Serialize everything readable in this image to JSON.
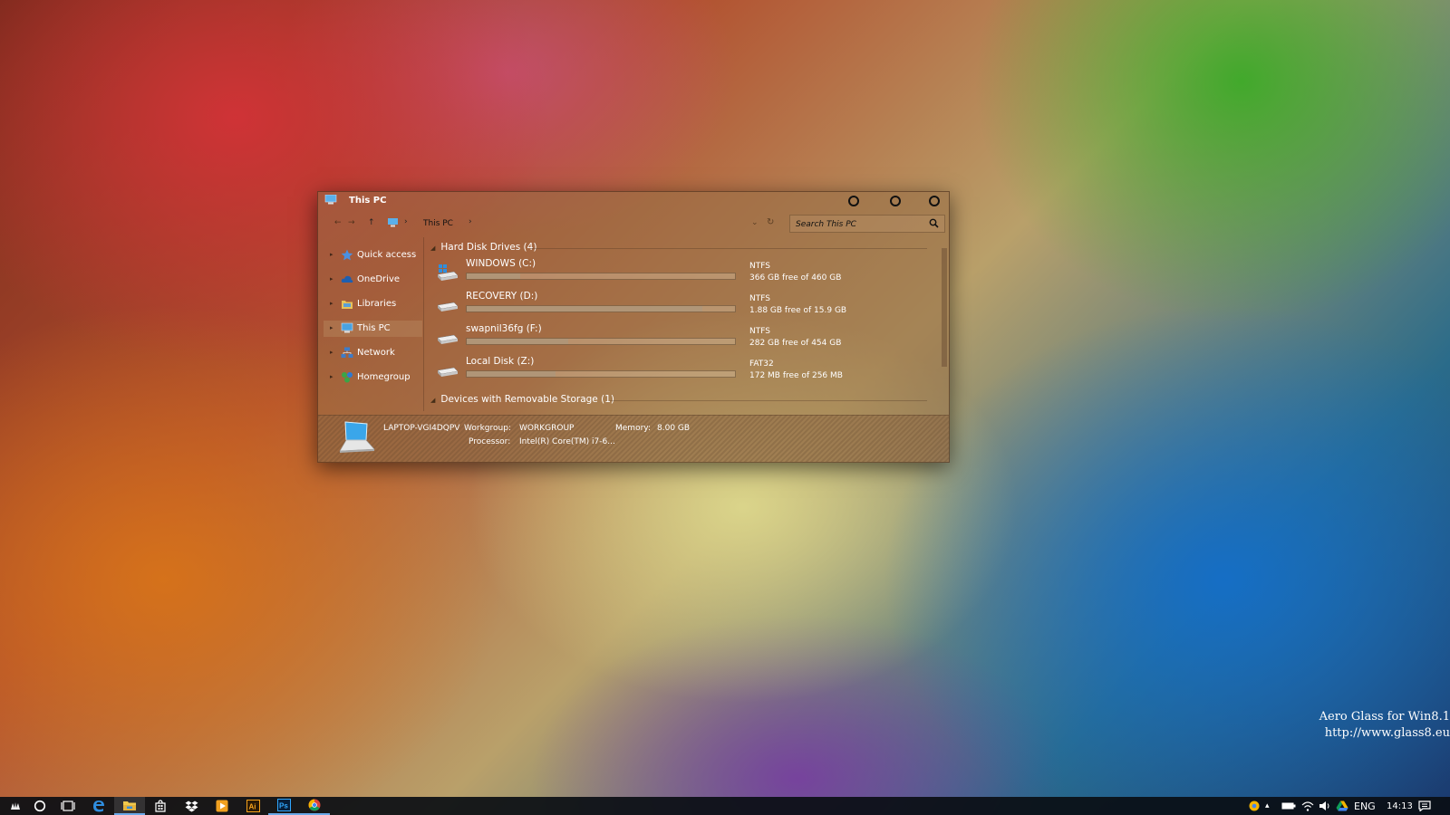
{
  "window": {
    "title": "This PC",
    "address": {
      "segments": [
        "This PC"
      ]
    },
    "search": {
      "placeholder": "Search This PC"
    },
    "sidebar": {
      "items": [
        {
          "label": "Quick access",
          "icon": "star-icon",
          "color": "#4a90e2",
          "selected": false
        },
        {
          "label": "OneDrive",
          "icon": "cloud-icon",
          "color": "#1e5fb0",
          "selected": false
        },
        {
          "label": "Libraries",
          "icon": "folder-icon",
          "color": "#e8c25a",
          "selected": false
        },
        {
          "label": "This PC",
          "icon": "computer-icon",
          "color": "#4aa3e0",
          "selected": true
        },
        {
          "label": "Network",
          "icon": "network-icon",
          "color": "#3d7cc9",
          "selected": false
        },
        {
          "label": "Homegroup",
          "icon": "homegroup-icon",
          "color": "#3aa547",
          "selected": false
        }
      ]
    },
    "groups": {
      "hard_disks": {
        "label": "Hard Disk Drives (4)"
      },
      "removable": {
        "label": "Devices with Removable Storage (1)"
      }
    },
    "drives": [
      {
        "name": "WINDOWS (C:)",
        "fs": "NTFS",
        "free_text": "366 GB free of 460 GB",
        "used_fraction": 0.2,
        "icon": "windows-drive-icon"
      },
      {
        "name": "RECOVERY (D:)",
        "fs": "NTFS",
        "free_text": "1.88 GB free of 15.9 GB",
        "used_fraction": 0.88,
        "icon": "hard-drive-icon"
      },
      {
        "name": "swapnil36fg (F:)",
        "fs": "NTFS",
        "free_text": "282 GB free of 454 GB",
        "used_fraction": 0.38,
        "icon": "hard-drive-icon"
      },
      {
        "name": "Local Disk (Z:)",
        "fs": "FAT32",
        "free_text": "172 MB free of 256 MB",
        "used_fraction": 0.33,
        "icon": "hard-drive-icon"
      }
    ],
    "details": {
      "computer_name": "LAPTOP-VGI4DQPV",
      "workgroup_label": "Workgroup:",
      "workgroup_value": "WORKGROUP",
      "memory_label": "Memory:",
      "memory_value": "8.00 GB",
      "processor_label": "Processor:",
      "processor_value": "Intel(R) Core(TM) i7-6..."
    }
  },
  "watermark": {
    "line1": "Aero Glass for Win8.1",
    "line2": "http://www.glass8.eu"
  },
  "taskbar": {
    "apps": [
      {
        "name": "start-button",
        "icon": "start-icon"
      },
      {
        "name": "cortana-button",
        "icon": "cortana-icon"
      },
      {
        "name": "task-view-button",
        "icon": "task-view-icon"
      },
      {
        "name": "edge-button",
        "icon": "edge-icon"
      },
      {
        "name": "file-explorer-button",
        "icon": "file-explorer-icon",
        "active": true
      },
      {
        "name": "store-button",
        "icon": "store-icon"
      },
      {
        "name": "dropbox-button",
        "icon": "dropbox-icon"
      },
      {
        "name": "media-player-button",
        "icon": "media-player-icon"
      },
      {
        "name": "illustrator-button",
        "icon": "illustrator-icon",
        "label": "Ai"
      },
      {
        "name": "photoshop-button",
        "icon": "photoshop-icon",
        "label": "Ps",
        "running": true
      },
      {
        "name": "chrome-button",
        "icon": "chrome-icon",
        "running": true
      }
    ],
    "tray": {
      "language": "ENG",
      "time": "14:13"
    }
  },
  "colors": {
    "accent": "#6aa9e8",
    "window_tint": "#966e46",
    "taskbar": "#0a0e14"
  }
}
